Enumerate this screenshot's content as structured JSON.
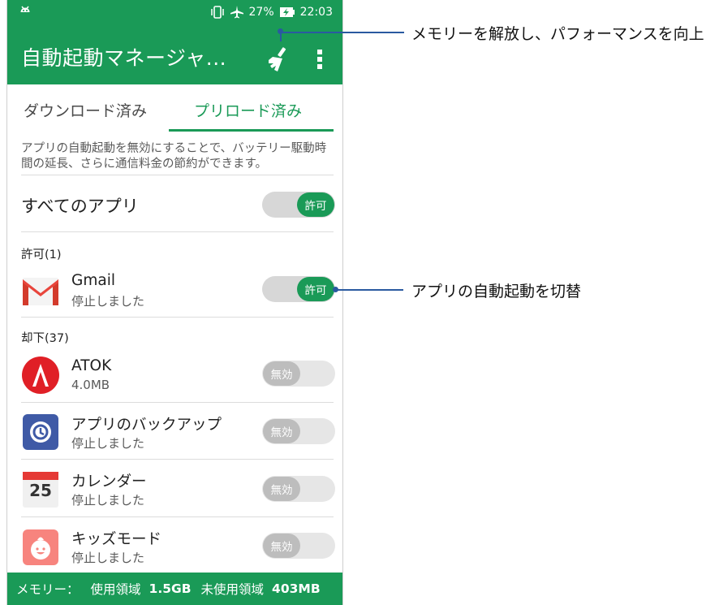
{
  "status_bar": {
    "battery_percent": "27%",
    "time": "22:03"
  },
  "app_bar": {
    "title": "自動起動マネージャ..."
  },
  "tabs": [
    {
      "label": "ダウンロード済み"
    },
    {
      "label": "プリロード済み"
    }
  ],
  "description": "アプリの自動起動を無効にすることで、バッテリー駆動時間の延長、さらに通信料金の節約ができます。",
  "all_apps": {
    "label": "すべてのアプリ",
    "toggle": "許可"
  },
  "allowed_section": {
    "label": "許可(1)"
  },
  "denied_section": {
    "label": "却下(37)"
  },
  "apps": [
    {
      "name": "Gmail",
      "sub": "停止しました",
      "toggle": "許可",
      "icon": "gmail-icon"
    },
    {
      "name": "ATOK",
      "sub": "4.0MB",
      "toggle": "無効",
      "icon": "atok-icon"
    },
    {
      "name": "アプリのバックアップ",
      "sub": "停止しました",
      "toggle": "無効",
      "icon": "backup-icon"
    },
    {
      "name": "カレンダー",
      "sub": "停止しました",
      "toggle": "無効",
      "icon": "calendar-icon",
      "icon_text": "25"
    },
    {
      "name": "キッズモード",
      "sub": "停止しました",
      "toggle": "無効",
      "icon": "kids-mode-icon"
    }
  ],
  "footer": {
    "memory_label": "メモリー：",
    "used_label": "使用領域",
    "used_value": "1.5GB",
    "free_label": "未使用領域",
    "free_value": "403MB"
  },
  "callouts": {
    "broom": "メモリーを解放し、パフォーマンスを向上",
    "toggle": "アプリの自動起動を切替"
  },
  "colors": {
    "accent": "#1a9a57",
    "callout": "#2a5aa0"
  }
}
